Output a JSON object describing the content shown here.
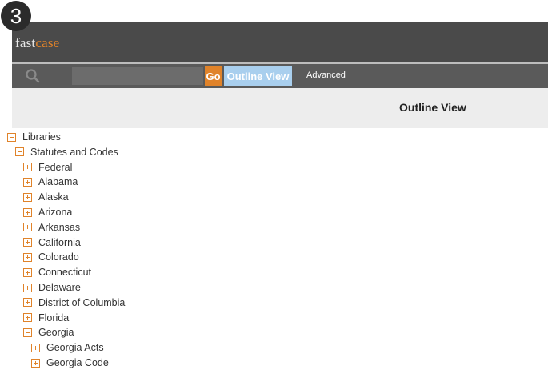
{
  "badge": {
    "step": "3"
  },
  "app": {
    "logo_part1": "fast",
    "logo_part2": "case"
  },
  "toolbar": {
    "search_placeholder": "",
    "go_label": "Go",
    "outline_view_label": "Outline View",
    "advanced_label": "Advanced"
  },
  "page": {
    "title": "Outline View"
  },
  "colors": {
    "accent_orange": "#e0832a",
    "header_bg": "#4a4a4a",
    "toolbar_bg": "#5a5a5a",
    "outline_button": "#a9cfee"
  },
  "tree": {
    "items": [
      {
        "label": "Libraries",
        "state": "expanded",
        "level": 0
      },
      {
        "label": "Statutes and Codes",
        "state": "expanded",
        "level": 1
      },
      {
        "label": "Federal",
        "state": "collapsed",
        "level": 2
      },
      {
        "label": "Alabama",
        "state": "collapsed",
        "level": 2
      },
      {
        "label": "Alaska",
        "state": "collapsed",
        "level": 2
      },
      {
        "label": "Arizona",
        "state": "collapsed",
        "level": 2
      },
      {
        "label": "Arkansas",
        "state": "collapsed",
        "level": 2
      },
      {
        "label": "California",
        "state": "collapsed",
        "level": 2
      },
      {
        "label": "Colorado",
        "state": "collapsed",
        "level": 2
      },
      {
        "label": "Connecticut",
        "state": "collapsed",
        "level": 2
      },
      {
        "label": "Delaware",
        "state": "collapsed",
        "level": 2
      },
      {
        "label": "District of Columbia",
        "state": "collapsed",
        "level": 2
      },
      {
        "label": "Florida",
        "state": "collapsed",
        "level": 2
      },
      {
        "label": "Georgia",
        "state": "expanded",
        "level": 2
      },
      {
        "label": "Georgia Acts",
        "state": "collapsed",
        "level": 3
      },
      {
        "label": "Georgia Code",
        "state": "collapsed",
        "level": 3
      }
    ]
  }
}
